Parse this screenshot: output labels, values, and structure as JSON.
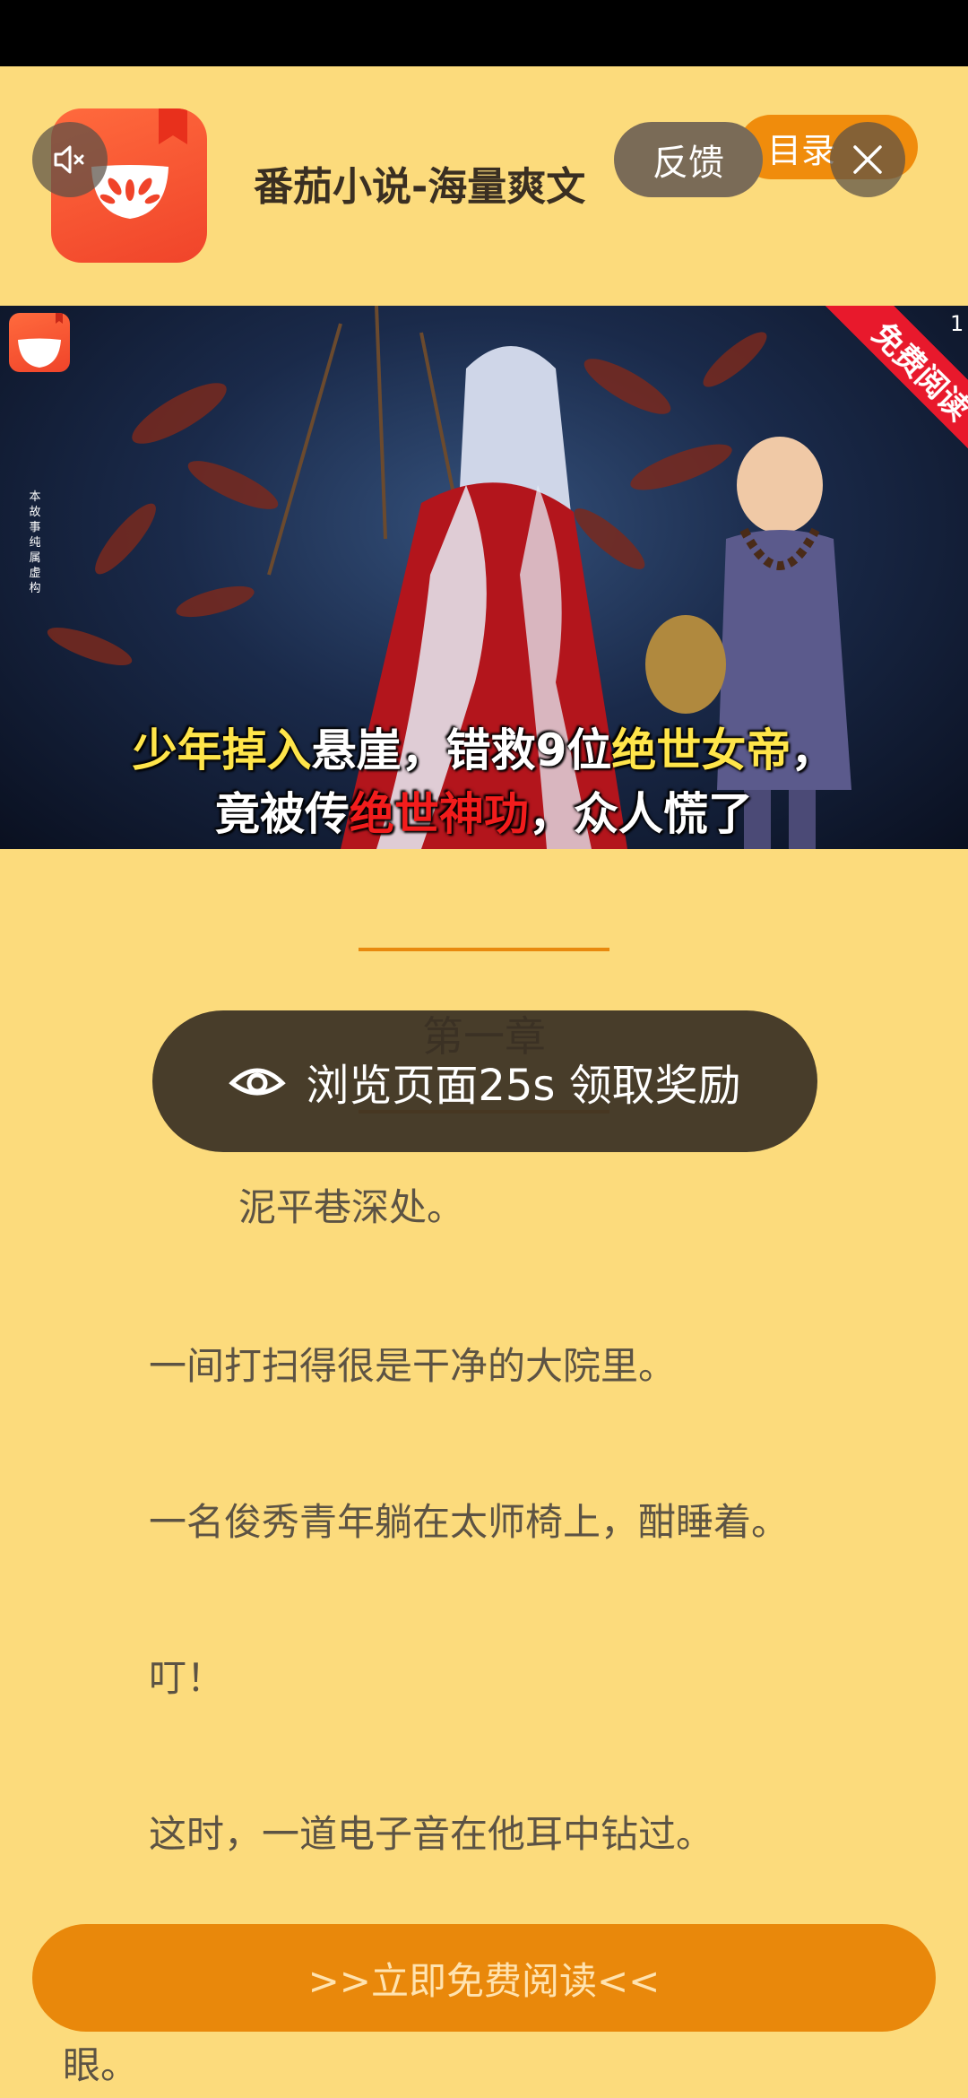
{
  "header": {
    "app_title": "番茄小说-海量爽文",
    "feedback_label": "反馈",
    "catalog_label": "目录"
  },
  "banner": {
    "page_indicator": "1",
    "ribbon_text": "免费阅读",
    "disclaimer": "本故事纯属虚构",
    "caption_line1": {
      "a": "少年掉入",
      "b": "悬崖，错救9位",
      "c": "绝世女帝",
      "d": "，"
    },
    "caption_line2": {
      "a": "竟被传",
      "b": "绝世神功",
      "c": "，众人慌了"
    }
  },
  "chapter": {
    "title": "第一章",
    "paragraphs": [
      "泥平巷深处。",
      "一间打扫得很是干净的大院里。",
      "一名俊秀青年躺在太师椅上，酣睡着。",
      "叮！",
      "这时，一道电子音在他耳中钻过。",
      "眼。"
    ]
  },
  "reward_toast": {
    "text": "浏览页面25s 领取奖励"
  },
  "read_button": {
    "label": ">>立即免费阅读<<"
  },
  "colors": {
    "background": "#FCDB7C",
    "accent": "#E9880B",
    "ribbon": "#e8192c"
  }
}
